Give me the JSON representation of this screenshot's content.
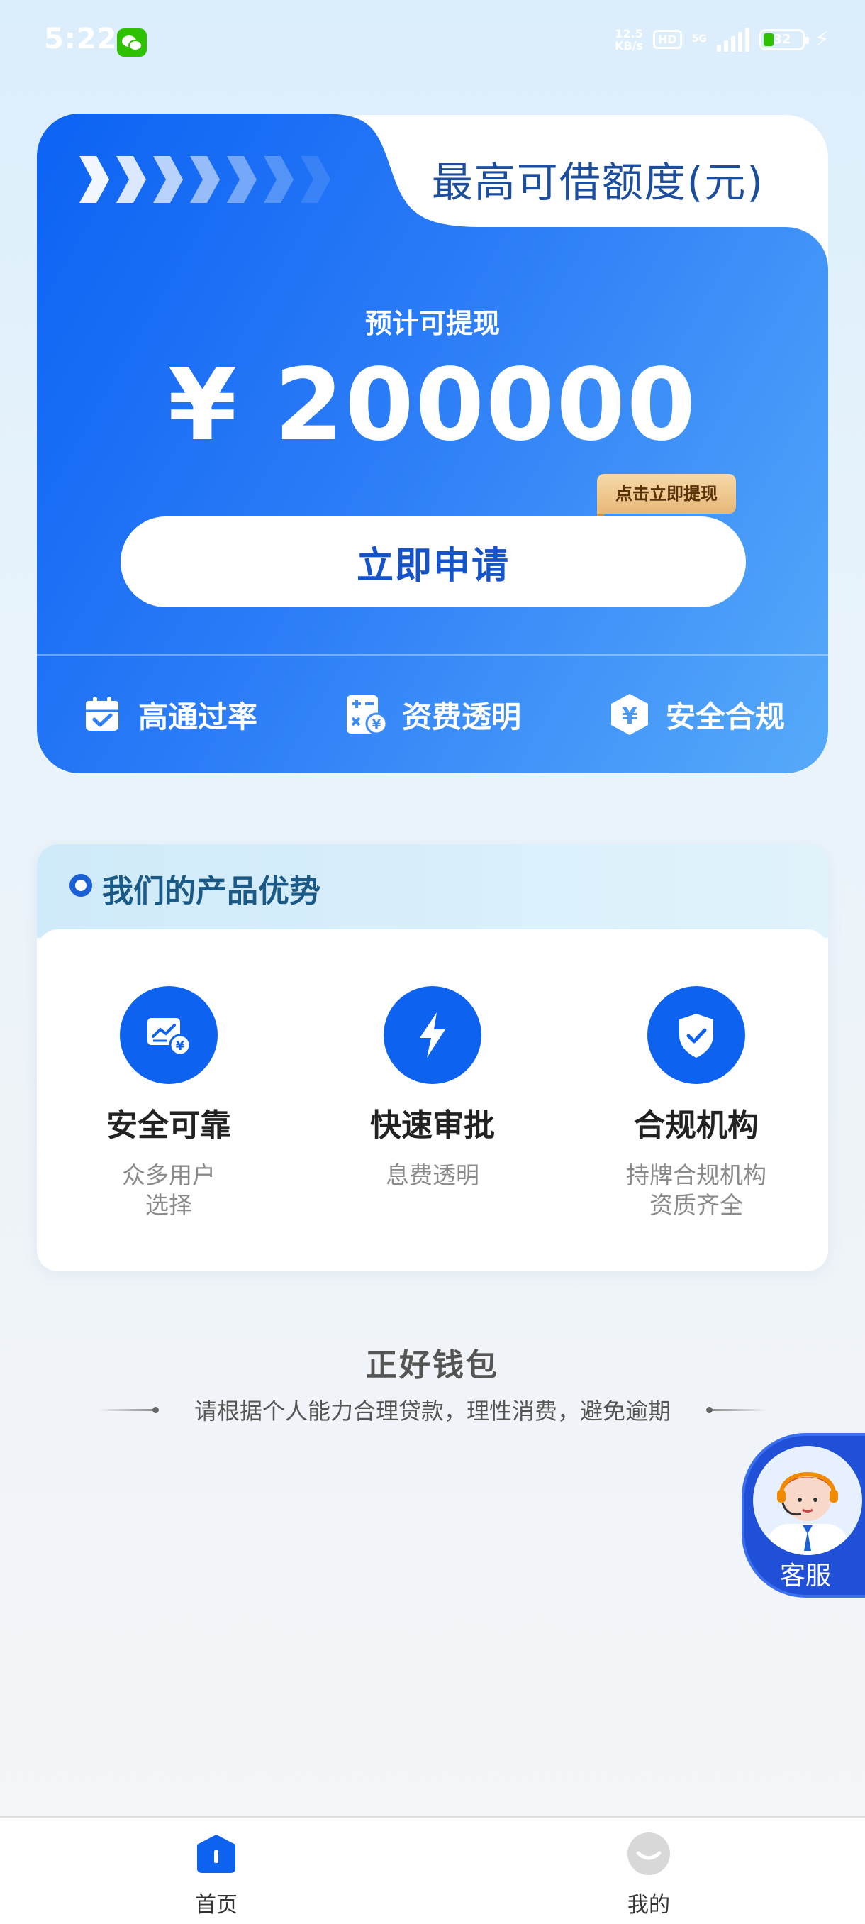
{
  "status_bar": {
    "time": "5:22",
    "net_speed_value": "12.5",
    "net_speed_unit": "KB/s",
    "hd": "HD",
    "network": "5G",
    "battery": "32"
  },
  "hero": {
    "title": "最高可借额度(元)",
    "subtitle": "预计可提现",
    "amount": "¥ 200000",
    "tip_badge": "点击立即提现",
    "apply_label": "立即申请",
    "features": [
      {
        "label": "高通过率",
        "icon": "calendar-check-icon"
      },
      {
        "label": "资费透明",
        "icon": "calculator-icon"
      },
      {
        "label": "安全合规",
        "icon": "yuan-shield-icon"
      }
    ],
    "colors": {
      "gradient_start": "#0c62f3",
      "gradient_end": "#56aaf9",
      "title": "#1d4e9e"
    }
  },
  "advantages": {
    "title": "我们的产品优势",
    "items": [
      {
        "name": "安全可靠",
        "desc": "众多用户\n选择",
        "icon": "chart-yuan-icon"
      },
      {
        "name": "快速审批",
        "desc": "息费透明",
        "icon": "lightning-icon"
      },
      {
        "name": "合规机构",
        "desc": "持牌合规机构\n资质齐全",
        "icon": "shield-check-icon"
      }
    ]
  },
  "footer": {
    "brand": "正好钱包",
    "slogan": "请根据个人能力合理贷款，理性消费，避免逾期"
  },
  "customer_service": {
    "label": "客服",
    "icon": "agent-avatar-icon"
  },
  "tabbar": {
    "items": [
      {
        "label": "首页",
        "icon": "home-icon",
        "active": true
      },
      {
        "label": "我的",
        "icon": "profile-icon",
        "active": false
      }
    ]
  }
}
